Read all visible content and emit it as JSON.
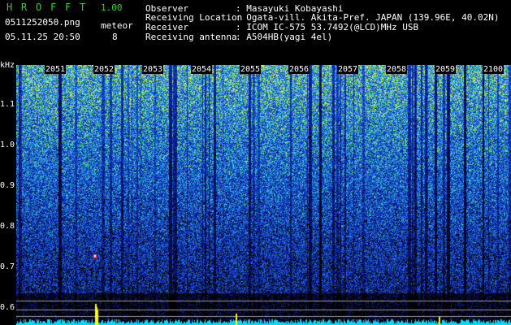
{
  "header": {
    "app_title_letters": [
      "H",
      "R",
      "O",
      "F",
      "F",
      "T"
    ],
    "version": "1.00",
    "filename": "0511252050.png",
    "mode_label": "meteor",
    "datetime": "05.11.25 20:50",
    "meteor_count": "8"
  },
  "info": {
    "observer_label": "Observer",
    "observer_value": ": Masayuki Kobayashi",
    "location_label": "Receiving Location",
    "location_value": ": Ogata-vill. Akita-Pref. JAPAN (139.96E, 40.02N)",
    "receiver_label": "Receiver",
    "receiver_value": ": ICOM IC-575 53.7492(@LCD)MHz USB",
    "antenna_label": "Receiving antenna",
    "antenna_value": ": A504HB(yagi 4el)"
  },
  "axis": {
    "y_unit": "kHz",
    "y_ticks": [
      "1.1",
      "1.0",
      "0.9",
      "0.8",
      "0.7",
      "0.6"
    ],
    "y_tick_values": [
      1.1,
      1.0,
      0.9,
      0.8,
      0.7,
      0.6
    ],
    "time_ticks": [
      "2051",
      "2052",
      "2053",
      "2054",
      "2055",
      "2056",
      "2057",
      "2058",
      "2059",
      "2100"
    ]
  },
  "colors": {
    "background": "#000000",
    "label_green": "#2bd62b",
    "label_white": "#ffffff",
    "spectrum_low": "#0a1a8c",
    "spectrum_mid": "#1e78e6",
    "spectrum_high": "#3ce0c8",
    "spectrum_peak": "#c8f050",
    "baseline": "#00d8ff",
    "meteor": "#ffff00"
  }
}
